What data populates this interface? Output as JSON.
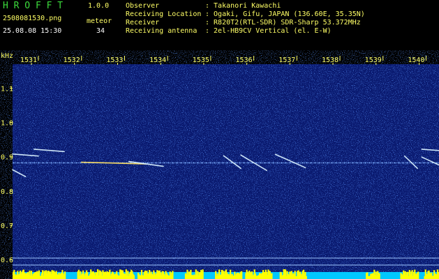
{
  "header": {
    "app_name": "H R O F F T",
    "version": "1.0.0",
    "filename": "2508081530.png",
    "datetime": "25.08.08 15:30",
    "meteor_label": "meteor",
    "meteor_count": "34",
    "info": [
      {
        "label": "Observer",
        "value": ": Takanori Kawachi"
      },
      {
        "label": "Receiving Location",
        "value": ": Ogaki, Gifu, JAPAN (136.60E, 35.35N)"
      },
      {
        "label": "Receiver",
        "value": ": R820T2(RTL-SDR) SDR-Sharp 53.372MHz"
      },
      {
        "label": "Receiving antenna",
        "value": ": 2el-HB9CV Vertical (el. E-W)"
      }
    ]
  },
  "chart_data": {
    "type": "heatmap",
    "ylabel": "kHz",
    "x_ticks": [
      "1531",
      "1532",
      "1533",
      "1534",
      "1535",
      "1536",
      "1537",
      "1538",
      "1539",
      "1540"
    ],
    "y_ticks": [
      "1.1",
      "1.0",
      "0.9",
      "0.8",
      "0.7",
      "0.6"
    ],
    "ylim": [
      0.58,
      1.17
    ],
    "xlim": [
      1530.4,
      1540.3
    ],
    "carrier_khz": 0.882,
    "colors": {
      "background": "#0a1a70",
      "noise": "#2a5cff",
      "strong": "#ffff44",
      "axis_text": "#ffff66",
      "power_bar": "#ffff00",
      "baseline": "#00c8ff"
    },
    "meteor_echoes": [
      {
        "start_s": 1530.4,
        "end_s": 1531.0,
        "start_khz": 0.908,
        "end_khz": 0.902
      },
      {
        "start_s": 1530.4,
        "end_s": 1530.7,
        "start_khz": 0.862,
        "end_khz": 0.842
      },
      {
        "start_s": 1530.9,
        "end_s": 1531.6,
        "start_khz": 0.922,
        "end_khz": 0.915
      },
      {
        "start_s": 1532.0,
        "end_s": 1533.5,
        "start_khz": 0.884,
        "end_khz": 0.879
      },
      {
        "start_s": 1533.1,
        "end_s": 1533.9,
        "start_khz": 0.886,
        "end_khz": 0.872
      },
      {
        "start_s": 1535.3,
        "end_s": 1535.7,
        "start_khz": 0.903,
        "end_khz": 0.866
      },
      {
        "start_s": 1535.7,
        "end_s": 1536.3,
        "start_khz": 0.905,
        "end_khz": 0.86
      },
      {
        "start_s": 1536.5,
        "end_s": 1537.2,
        "start_khz": 0.907,
        "end_khz": 0.868
      },
      {
        "start_s": 1539.5,
        "end_s": 1539.8,
        "start_khz": 0.902,
        "end_khz": 0.866
      },
      {
        "start_s": 1539.9,
        "end_s": 1540.3,
        "start_khz": 0.922,
        "end_khz": 0.918
      },
      {
        "start_s": 1539.9,
        "end_s": 1540.3,
        "start_khz": 0.899,
        "end_khz": 0.876
      }
    ]
  }
}
